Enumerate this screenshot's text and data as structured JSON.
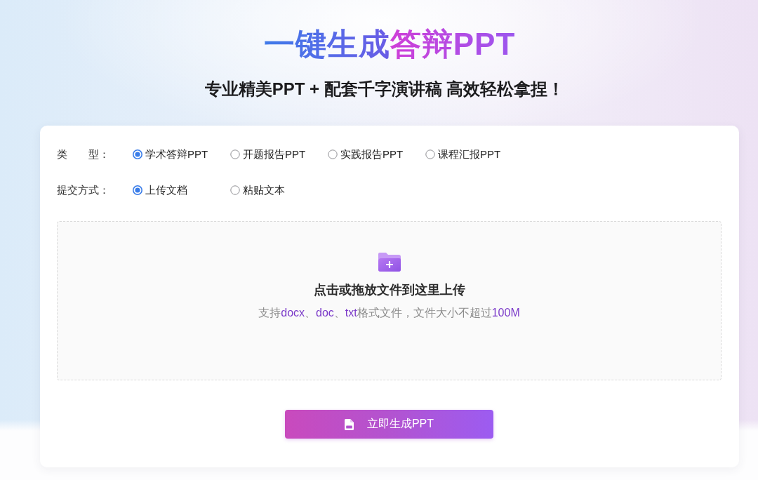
{
  "header": {
    "title": [
      {
        "text": "一键生成",
        "accent": false
      },
      {
        "text": "答辩PPT",
        "accent": true
      }
    ],
    "subtitle": "专业精美PPT + 配套千字演讲稿 高效轻松拿捏！"
  },
  "form": {
    "fields": [
      {
        "label": "类　　型：",
        "options": [
          {
            "label": "学术答辩PPT",
            "selected": true
          },
          {
            "label": "开题报告PPT",
            "selected": false
          },
          {
            "label": "实践报告PPT",
            "selected": false
          },
          {
            "label": "课程汇报PPT",
            "selected": false
          }
        ]
      },
      {
        "label": "提交方式：",
        "options": [
          {
            "label": "上传文档",
            "selected": true
          },
          {
            "label": "粘贴文本",
            "selected": false
          }
        ]
      }
    ]
  },
  "upload": {
    "title": "点击或拖放文件到这里上传",
    "hint": [
      {
        "text": "支持",
        "highlight": false
      },
      {
        "text": "docx",
        "highlight": true
      },
      {
        "text": "、",
        "highlight": false
      },
      {
        "text": "doc",
        "highlight": true
      },
      {
        "text": "、",
        "highlight": false
      },
      {
        "text": "txt",
        "highlight": true
      },
      {
        "text": "格式文件，文件大小不超过",
        "highlight": false
      },
      {
        "text": "100M",
        "highlight": true
      }
    ]
  },
  "submit_button": {
    "label": "立即生成PPT"
  }
}
